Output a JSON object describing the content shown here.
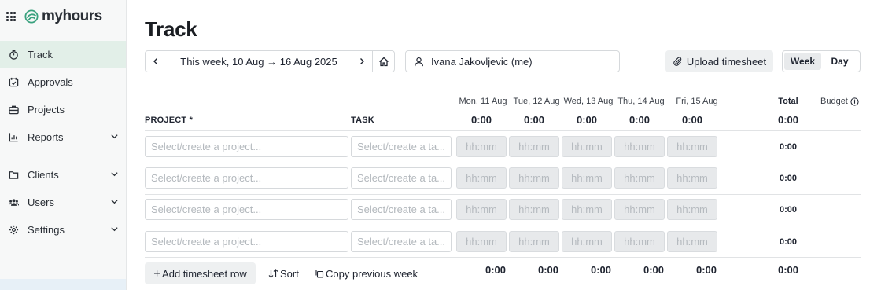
{
  "brand": {
    "name": "myhours",
    "accent": "#3aa17e"
  },
  "sidebar": {
    "items": [
      {
        "label": "Track",
        "icon": "stopwatch-icon",
        "active": true
      },
      {
        "label": "Approvals",
        "icon": "calendar-check-icon"
      },
      {
        "label": "Projects",
        "icon": "briefcase-icon"
      },
      {
        "label": "Reports",
        "icon": "bar-chart-icon",
        "expandable": true
      },
      {
        "label": "Clients",
        "icon": "folder-icon",
        "expandable": true
      },
      {
        "label": "Users",
        "icon": "users-icon",
        "expandable": true
      },
      {
        "label": "Settings",
        "icon": "gear-icon",
        "expandable": true
      }
    ]
  },
  "page": {
    "title": "Track"
  },
  "toolbar": {
    "date_range": "This week, 10 Aug → 16 Aug 2025",
    "user": "Ivana Jakovljevic (me)",
    "upload_label": "Upload timesheet",
    "view_week": "Week",
    "view_day": "Day",
    "selected_view": "Week"
  },
  "table": {
    "project_header": "PROJECT *",
    "task_header": "TASK",
    "total_header": "Total",
    "budget_header": "Budget",
    "days": [
      {
        "label": "Mon, 11 Aug",
        "total": "0:00"
      },
      {
        "label": "Tue, 12 Aug",
        "total": "0:00"
      },
      {
        "label": "Wed, 13 Aug",
        "total": "0:00"
      },
      {
        "label": "Thu, 14 Aug",
        "total": "0:00"
      },
      {
        "label": "Fri, 15 Aug",
        "total": "0:00"
      }
    ],
    "header_total": "0:00",
    "project_placeholder": "Select/create a project...",
    "task_placeholder": "Select/create a ta...",
    "time_placeholder": "hh:mm",
    "rows": [
      {
        "total": "0:00"
      },
      {
        "total": "0:00"
      },
      {
        "total": "0:00"
      },
      {
        "total": "0:00"
      }
    ],
    "footer_totals": [
      "0:00",
      "0:00",
      "0:00",
      "0:00",
      "0:00"
    ],
    "footer_grand_total": "0:00"
  },
  "actions": {
    "add_row": "Add timesheet row",
    "sort": "Sort",
    "copy": "Copy previous week"
  }
}
